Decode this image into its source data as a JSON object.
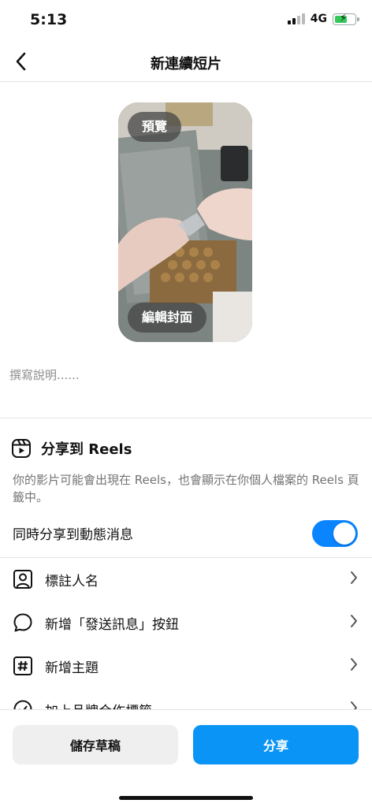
{
  "status_bar": {
    "time": "5:13",
    "network": "4G"
  },
  "nav": {
    "title": "新連續短片",
    "back_icon": "chevron-left-icon"
  },
  "preview": {
    "preview_label": "預覽",
    "edit_cover_label": "編輯封面"
  },
  "caption": {
    "placeholder": "撰寫說明......"
  },
  "share_reels": {
    "title": "分享到 Reels",
    "icon": "reels-icon",
    "description": "你的影片可能會出現在 Reels，也會顯示在你個人檔案的 Reels 頁籤中。"
  },
  "feed_toggle": {
    "label": "同時分享到動態消息",
    "on": true
  },
  "options": [
    {
      "label": "標註人名",
      "icon": "tag-people-icon"
    },
    {
      "label": "新增「發送訊息」按鈕",
      "icon": "message-bubble-icon"
    },
    {
      "label": "新增主題",
      "icon": "hashtag-icon"
    },
    {
      "label": "加上品牌合作標籤",
      "icon": "brand-partner-icon"
    }
  ],
  "buttons": {
    "save_draft": "儲存草稿",
    "share": "分享"
  },
  "colors": {
    "accent": "#0a95f6",
    "toggle_on": "#0a84ff",
    "battery": "#35c759"
  }
}
